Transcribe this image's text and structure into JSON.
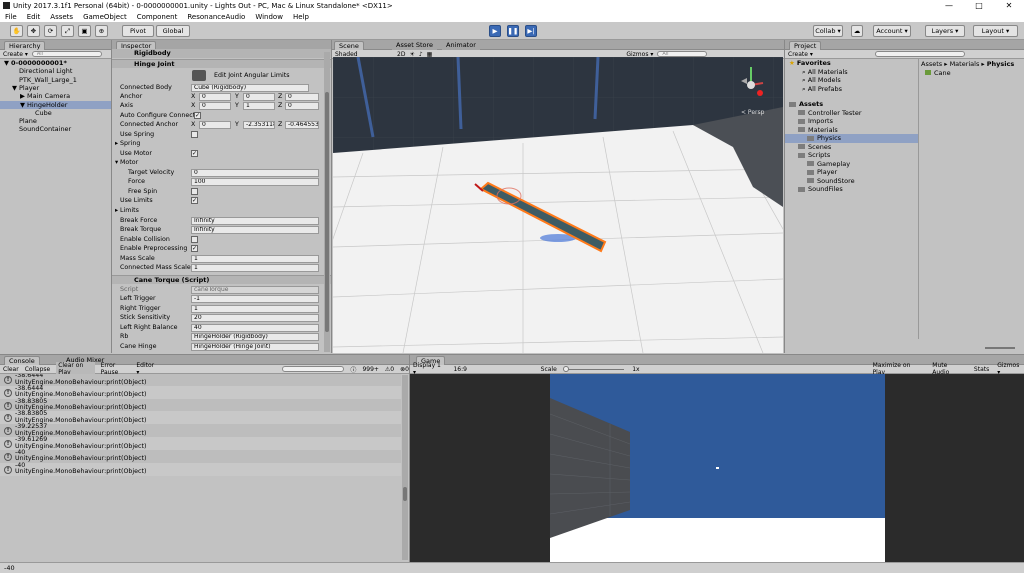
{
  "window": {
    "title": "Unity 2017.3.1f1 Personal (64bit) - 0-0000000001.unity - Lights Out - PC, Mac & Linux Standalone* <DX11>",
    "min": "—",
    "max": "□",
    "close": "✕"
  },
  "menu": [
    "File",
    "Edit",
    "Assets",
    "GameObject",
    "Component",
    "ResonanceAudio",
    "Window",
    "Help"
  ],
  "toolbar": {
    "pivot": "Pivot",
    "global": "Global",
    "collab": "Collab ▾",
    "account": "Account ▾",
    "layers": "Layers ▾",
    "layout": "Layout ▾"
  },
  "hierarchy": {
    "tab": "Hierarchy",
    "create": "Create ▾",
    "search": "All",
    "items": [
      {
        "label": "0-0000000001*",
        "indent": 0,
        "bold": true,
        "arrow": "▼"
      },
      {
        "label": "Directional Light",
        "indent": 1,
        "arrow": ""
      },
      {
        "label": "PTK_Wall_Large_1",
        "indent": 1,
        "arrow": ""
      },
      {
        "label": "Player",
        "indent": 1,
        "arrow": "▼"
      },
      {
        "label": "Main Camera",
        "indent": 2,
        "arrow": "▶"
      },
      {
        "label": "HingeHolder",
        "indent": 2,
        "arrow": "▼",
        "selected": true
      },
      {
        "label": "Cube",
        "indent": 3,
        "arrow": ""
      },
      {
        "label": "Plane",
        "indent": 1,
        "arrow": ""
      },
      {
        "label": "SoundContainer",
        "indent": 1,
        "arrow": ""
      }
    ]
  },
  "inspector": {
    "tab": "Inspector",
    "rigidbody_title": "Rigidbody",
    "hinge_title": "Hinge Joint",
    "edit_joint": "Edit Joint Angular Limits",
    "rows": {
      "connected_body_label": "Connected Body",
      "connected_body": "Cube (Rigidbody)",
      "anchor_label": "Anchor",
      "anchor": [
        "0",
        "0",
        "0"
      ],
      "axis_label": "Axis",
      "axis": [
        "0",
        "1",
        "0"
      ],
      "auto_label": "Auto Configure Connect",
      "connected_anchor_label": "Connected Anchor",
      "connected_anchor": [
        "0",
        "-2.353118",
        "-0.464553"
      ],
      "use_spring_label": "Use Spring",
      "spring_label": "Spring",
      "use_motor_label": "Use Motor",
      "motor_label": "Motor",
      "target_velocity_label": "Target Velocity",
      "target_velocity": "0",
      "force_label": "Force",
      "force": "100",
      "free_spin_label": "Free Spin",
      "use_limits_label": "Use Limits",
      "limits_label": "Limits",
      "break_force_label": "Break Force",
      "break_force": "Infinity",
      "break_torque_label": "Break Torque",
      "break_torque": "Infinity",
      "enable_collision_label": "Enable Collision",
      "enable_preprocessing_label": "Enable Preprocessing",
      "mass_scale_label": "Mass Scale",
      "mass_scale": "1",
      "connected_mass_scale_label": "Connected Mass Scale",
      "connected_mass_scale": "1"
    },
    "axis_letters": [
      "X",
      "Y",
      "Z"
    ],
    "script_title": "Cane Torque (Script)",
    "script": {
      "script_label": "Script",
      "script": "caneTorque",
      "left_trigger_label": "Left Trigger",
      "left_trigger": "-1",
      "right_trigger_label": "Right Trigger",
      "right_trigger": "1",
      "stick_label": "Stick Sensitivity",
      "stick": "20",
      "lrb_label": "Left Right Balance",
      "lrb": "40",
      "rb_label": "Rb",
      "rb": "HingeHolder (Rigidbody)",
      "cane_hinge_label": "Cane Hinge",
      "cane_hinge": "HingeHolder (Hinge Joint)"
    }
  },
  "scene": {
    "tab_scene": "Scene",
    "tab_asset": "Asset Store",
    "tab_animator": "Animator",
    "shaded": "Shaded",
    "twod": "2D",
    "gizmos": "Gizmos ▾",
    "search": "All",
    "persp": "< Persp",
    "colors": {
      "sky": "#2d3540",
      "floor": "#f2f2f2",
      "wall": "#4b4f55",
      "cane": "#3e5c64",
      "outline": "#ff7a1a"
    }
  },
  "project": {
    "tab": "Project",
    "create": "Create ▾",
    "favorites": "Favorites",
    "fav_items": [
      "All Materials",
      "All Models",
      "All Prefabs"
    ],
    "assets": "Assets",
    "folders": [
      {
        "label": "Controller Tester",
        "indent": 1
      },
      {
        "label": "Imports",
        "indent": 1
      },
      {
        "label": "Materials",
        "indent": 1
      },
      {
        "label": "Physics",
        "indent": 2,
        "selected": true
      },
      {
        "label": "Scenes",
        "indent": 1
      },
      {
        "label": "Scripts",
        "indent": 1
      },
      {
        "label": "Gameplay",
        "indent": 2
      },
      {
        "label": "Player",
        "indent": 2
      },
      {
        "label": "SoundStore",
        "indent": 2
      },
      {
        "label": "SoundFiles",
        "indent": 1
      }
    ],
    "breadcrumb": [
      "Assets",
      "Materials",
      "Physics"
    ],
    "file": "Cane"
  },
  "console": {
    "tab": "Console",
    "tab_audio": "Audio Mixer",
    "buttons": [
      "Clear",
      "Collapse",
      "Clear on Play",
      "Error Pause",
      "Editor ▾"
    ],
    "count": "999+",
    "entries": [
      {
        "value": "-38.6444",
        "source": "UnityEngine.MonoBehaviour:print(Object)"
      },
      {
        "value": "-38.6444",
        "source": "UnityEngine.MonoBehaviour:print(Object)"
      },
      {
        "value": "-38.83805",
        "source": "UnityEngine.MonoBehaviour:print(Object)"
      },
      {
        "value": "-38.83805",
        "source": "UnityEngine.MonoBehaviour:print(Object)"
      },
      {
        "value": "-39.22537",
        "source": "UnityEngine.MonoBehaviour:print(Object)"
      },
      {
        "value": "-39.61269",
        "source": "UnityEngine.MonoBehaviour:print(Object)"
      },
      {
        "value": "-40",
        "source": "UnityEngine.MonoBehaviour:print(Object)"
      },
      {
        "value": "-40",
        "source": "UnityEngine.MonoBehaviour:print(Object)"
      }
    ]
  },
  "game": {
    "tab": "Game",
    "display": "Display 1 ▾",
    "aspect": "16:9",
    "scale_label": "Scale",
    "scale_value": "1x",
    "maximize": "Maximize on Play",
    "mute": "Mute Audio",
    "stats": "Stats",
    "gizmos": "Gizmos ▾",
    "colors": {
      "sky": "#2f5a9a",
      "floor": "#ffffff",
      "wall": "#4a4c50"
    }
  },
  "status": "-40"
}
